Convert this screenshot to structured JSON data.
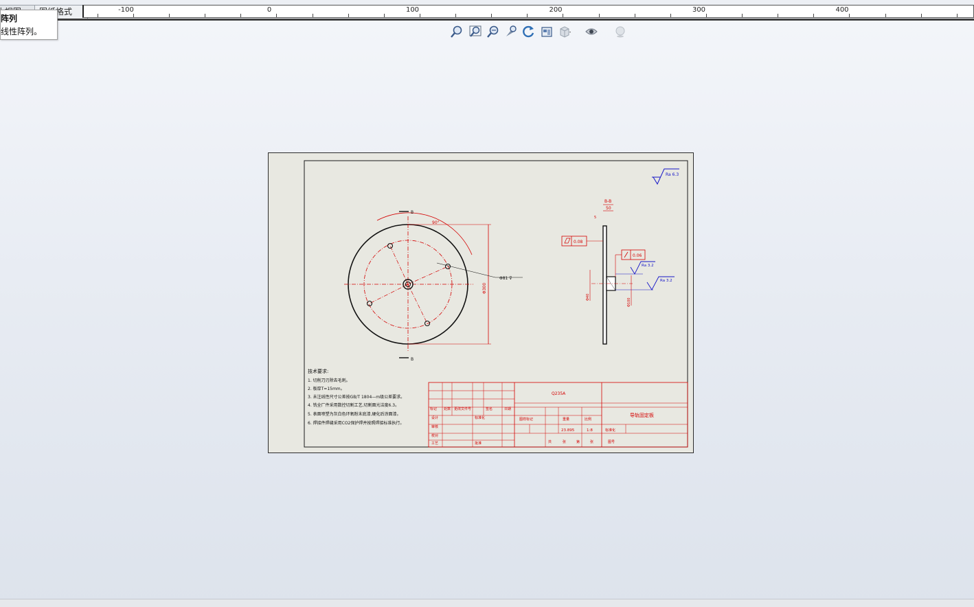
{
  "tabs": [
    {
      "label": "模型 视图"
    },
    {
      "label": "图纸格式"
    }
  ],
  "ruler": {
    "labels": [
      "-100",
      "0",
      "100",
      "200",
      "300",
      "400"
    ]
  },
  "tooltip": {
    "title": "阵列",
    "description": "线性阵列。"
  },
  "view_toolbar": {
    "icons": [
      "zoom-to-fit-icon",
      "zoom-to-area-icon",
      "zoom-in-out-icon",
      "zoom-to-selection-icon",
      "rotate-view-icon",
      "3d-drawing-view-icon",
      "display-style-icon",
      "hide-show-items-icon",
      "apply-scene-icon"
    ]
  },
  "drawing": {
    "roughness_top": "Ra 6.3",
    "section_label_top": "B",
    "section_label_bottom": "B",
    "section_view_label": "B-B",
    "angle_label": "90°",
    "diameter_label": "Φ300",
    "hole_label": "Φ81 ⊽",
    "flatness_value": "0.08",
    "runout_value": "0.06",
    "roughness_1": "Ra 3.2",
    "roughness_2": "Ra 3.2",
    "dim_top": "50",
    "dim_side_1": "Φ40",
    "dim_side_2": "Φ100",
    "dim_thickness": "5",
    "notes_title": "技术要求:",
    "notes": [
      "1. 切削刀刃除去毛刺。",
      "2. 板厚T=15mm。",
      "3. 未注线性尺寸公差按GB/T 1804—m级公差要求。",
      "4. 铣全厂件采用数控切割工艺,切割面光洁度6.3。",
      "5. 表面喷塑为灰白色环氧粉末底漆,硬化后涂面漆。",
      "6. 焊接件焊缝采用CO2保护焊并按照焊接标准执行。"
    ],
    "title_block": {
      "material": "Q235A",
      "part_name": "导轨固定板",
      "weight": "23.895",
      "scale": "1:8",
      "headers": [
        "标记",
        "处数",
        "更改文件号",
        "签名",
        "日期",
        "图样标记",
        "重量",
        "比例"
      ],
      "roles": [
        "设计",
        "审核",
        "校对",
        "工艺",
        "批准",
        "标准化"
      ],
      "misc": [
        "共",
        "张",
        "第",
        "张",
        "图号",
        "标准化"
      ]
    }
  },
  "colors": {
    "accent_red": "#d40000",
    "accent_blue": "#1414c8",
    "sheet_bg": "#e8e8e1"
  }
}
